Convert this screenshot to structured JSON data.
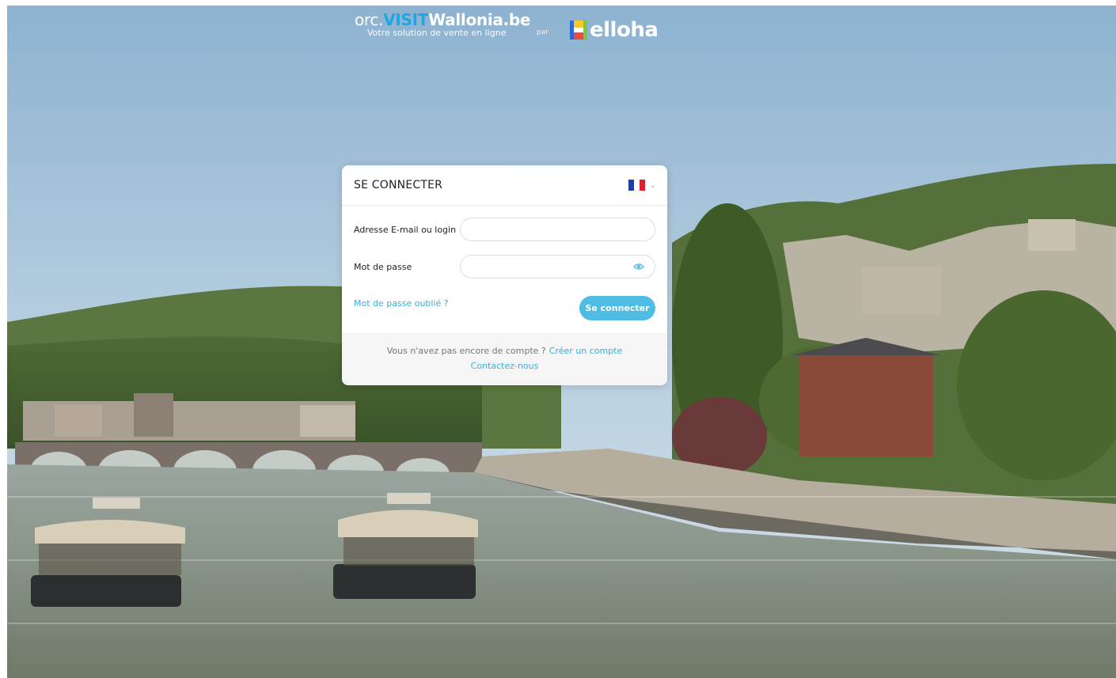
{
  "header": {
    "brand_prefix": "orc.",
    "brand_visit": "VISIT",
    "brand_wallonia": "Wallonia",
    "brand_suffix": ".be",
    "tagline": "Votre solution de vente en ligne",
    "par": "par",
    "partner": "elloha"
  },
  "login": {
    "title": "SE CONNECTER",
    "language_flag": "fr",
    "email_label": "Adresse E-mail ou login",
    "email_value": "",
    "password_label": "Mot de passe",
    "password_value": "",
    "forgot_link": "Mot de passe oublié ?",
    "submit_label": "Se connecter",
    "no_account_text": "Vous n'avez pas encore de compte ?",
    "create_account_link": "Créer un compte",
    "contact_link": "Contactez-nous"
  },
  "colors": {
    "accent": "#4fbde3",
    "link": "#3aaedc",
    "visit_blue": "#1fa6e6"
  },
  "icons": {
    "flag": "france-flag-icon",
    "chevron": "chevron-down-icon",
    "password_toggle": "eye-icon"
  }
}
